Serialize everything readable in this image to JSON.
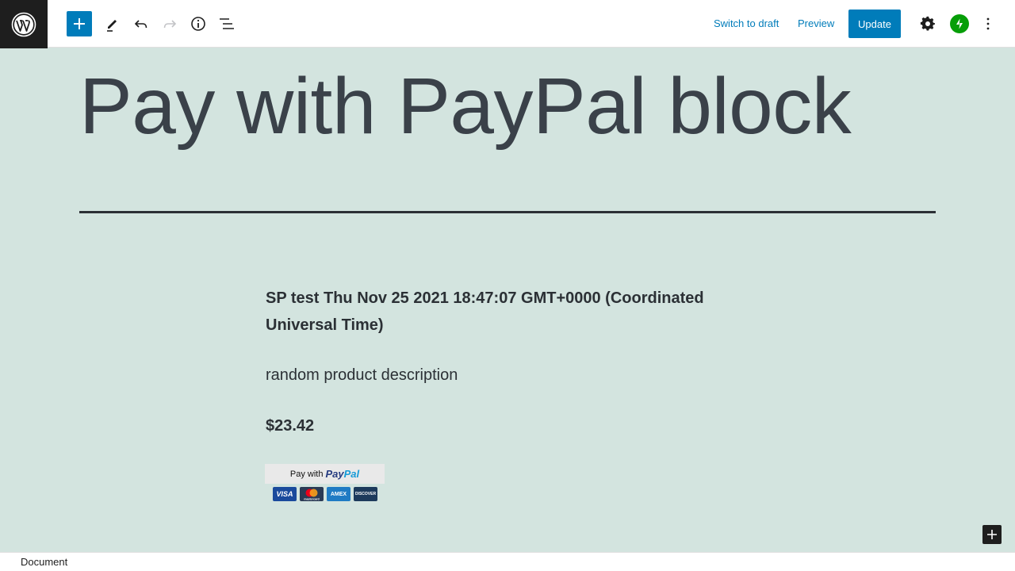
{
  "toolbar": {
    "switch_to_draft": "Switch to draft",
    "preview": "Preview",
    "update": "Update",
    "icons": [
      "wordpress-icon",
      "plus-icon",
      "pencil-icon",
      "undo-icon",
      "redo-icon",
      "info-icon",
      "list-view-icon",
      "gear-icon",
      "jetpack-icon",
      "more-vertical-icon"
    ]
  },
  "post": {
    "title": "Pay with PayPal block"
  },
  "product": {
    "title": "SP test Thu Nov 25 2021 18:47:07 GMT+0000 (Coordinated Universal Time)",
    "description": "random product description",
    "price": "$23.42"
  },
  "paypal_button": {
    "label": "Pay with",
    "brand_part1": "Pay",
    "brand_part2": "Pal",
    "cards": [
      "VISA",
      "mastercard",
      "AMEX",
      "DISCOVER"
    ]
  },
  "footer": {
    "breadcrumb": "Document"
  },
  "colors": {
    "accent": "#007cba",
    "background": "#d3e4df",
    "jetpack": "#069e08"
  }
}
